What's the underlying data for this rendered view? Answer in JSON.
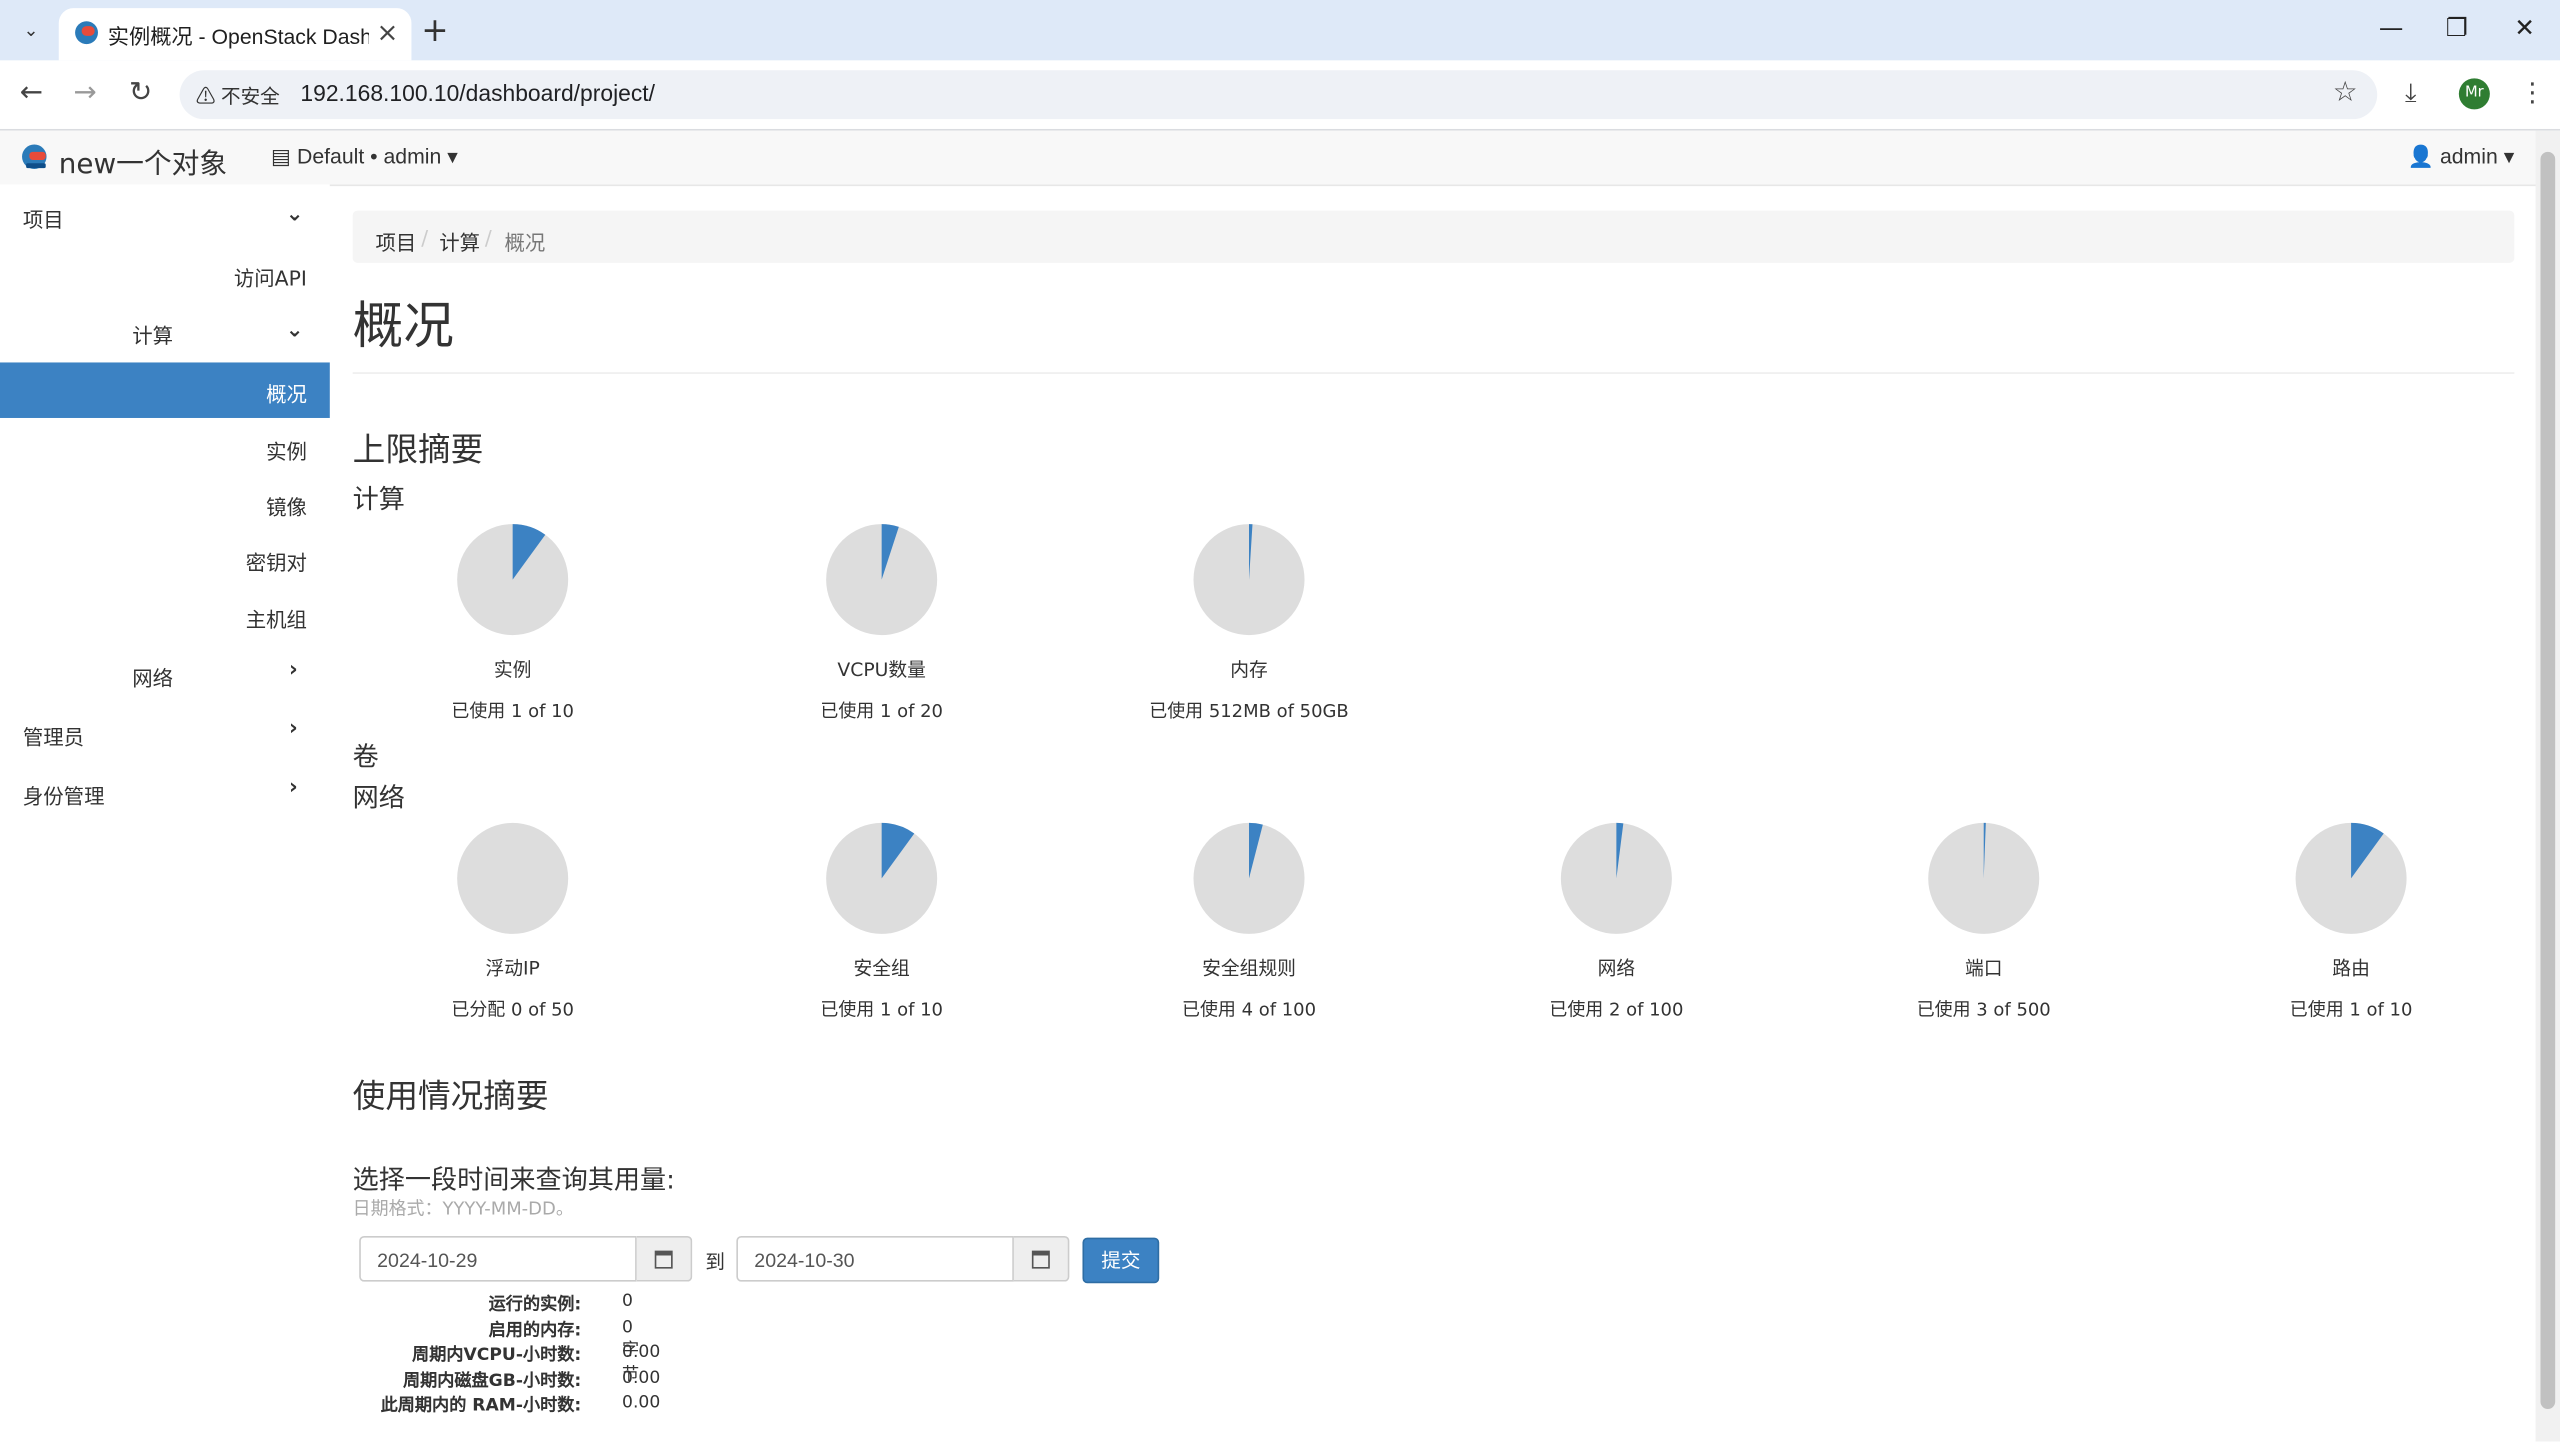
{
  "browser": {
    "tab_title": "实例概况 - OpenStack Dashboard",
    "insecure_label": "不安全",
    "url": "192.168.100.10/dashboard/project/",
    "profile_initials": "Mr"
  },
  "header": {
    "brand": "new一个对象",
    "context": "Default • admin",
    "user": "admin"
  },
  "sidebar": {
    "project": "项目",
    "api_access": "访问API",
    "compute": "计算",
    "overview": "概况",
    "instances": "实例",
    "images": "镜像",
    "key_pairs": "密钥对",
    "server_groups": "主机组",
    "network": "网络",
    "admin": "管理员",
    "identity": "身份管理"
  },
  "breadcrumb": [
    "项目",
    "计算",
    "概况"
  ],
  "page_title": "概况",
  "limits": {
    "heading": "上限摘要",
    "compute_heading": "计算",
    "volume_heading": "卷",
    "network_heading": "网络",
    "compute": [
      {
        "title": "实例",
        "usage": "已使用 1 of 10",
        "fraction": 0.1
      },
      {
        "title": "VCPU数量",
        "usage": "已使用 1 of 20",
        "fraction": 0.05
      },
      {
        "title": "内存",
        "usage": "已使用 512MB of 50GB",
        "fraction": 0.01
      }
    ],
    "network": [
      {
        "title": "浮动IP",
        "usage": "已分配 0 of 50",
        "fraction": 0
      },
      {
        "title": "安全组",
        "usage": "已使用 1 of 10",
        "fraction": 0.1
      },
      {
        "title": "安全组规则",
        "usage": "已使用 4 of 100",
        "fraction": 0.04
      },
      {
        "title": "网络",
        "usage": "已使用 2 of 100",
        "fraction": 0.02
      },
      {
        "title": "端口",
        "usage": "已使用 3 of 500",
        "fraction": 0.006
      },
      {
        "title": "路由",
        "usage": "已使用 1 of 10",
        "fraction": 0.1
      }
    ]
  },
  "usage": {
    "heading": "使用情况摘要",
    "query_label": "选择一段时间来查询其用量:",
    "date_hint": "日期格式：YYYY-MM-DD。",
    "start_date": "2024-10-29",
    "to_label": "到",
    "end_date": "2024-10-30",
    "submit_label": "提交",
    "stats": [
      {
        "key": "运行的实例:",
        "value": "0"
      },
      {
        "key": "启用的内存:",
        "value": "0字节"
      },
      {
        "key": "周期内VCPU-小时数:",
        "value": "0.00"
      },
      {
        "key": "周期内磁盘GB-小时数:",
        "value": "0.00"
      },
      {
        "key": "此周期内的 RAM-小时数:",
        "value": "0.00"
      }
    ]
  },
  "colors": {
    "accent": "#3c82c3",
    "pie_bg": "#dddddd"
  }
}
